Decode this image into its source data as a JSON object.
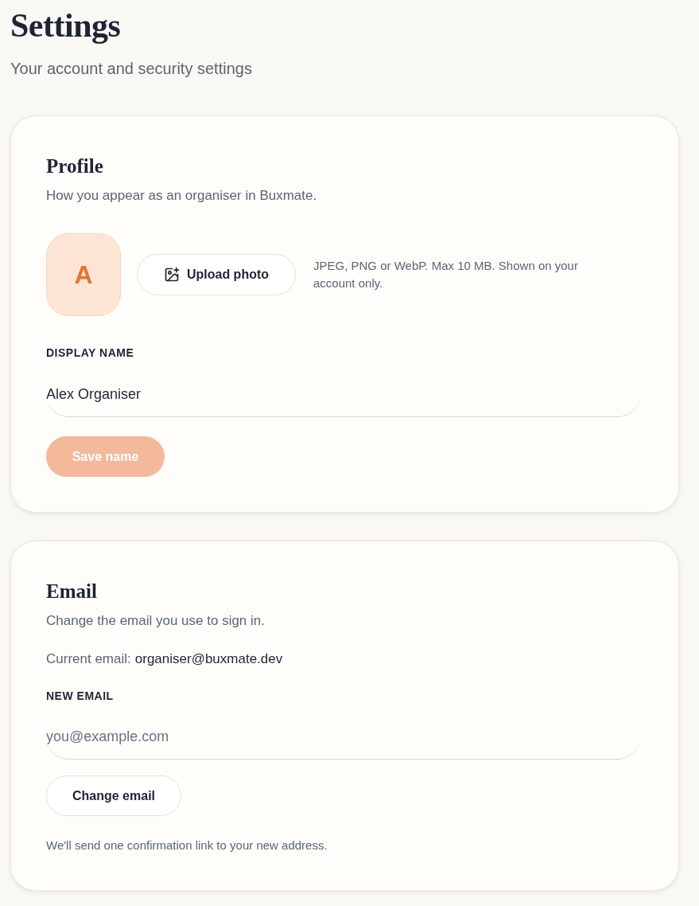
{
  "page": {
    "title": "Settings",
    "subtitle": "Your account and security settings"
  },
  "profile": {
    "title": "Profile",
    "description": "How you appear as an organiser in Buxmate.",
    "avatar": {
      "initial": "A"
    },
    "upload_button": "Upload photo",
    "upload_hint": "JPEG, PNG or WebP. Max 10 MB. Shown on your account only.",
    "display_name": {
      "label": "DISPLAY NAME",
      "value": "Alex Organiser"
    },
    "save_button": {
      "label": "Save name",
      "disabled": true
    }
  },
  "email": {
    "title": "Email",
    "description": "Change the email you use to sign in.",
    "current_email": {
      "label": "Current email:",
      "value": "organiser@buxmate.dev"
    },
    "new_email": {
      "label": "NEW EMAIL",
      "placeholder": "you@example.com"
    },
    "change_button": {
      "label": "Change email",
      "disabled": false
    },
    "note": "We'll send one confirmation link to your new address."
  }
}
